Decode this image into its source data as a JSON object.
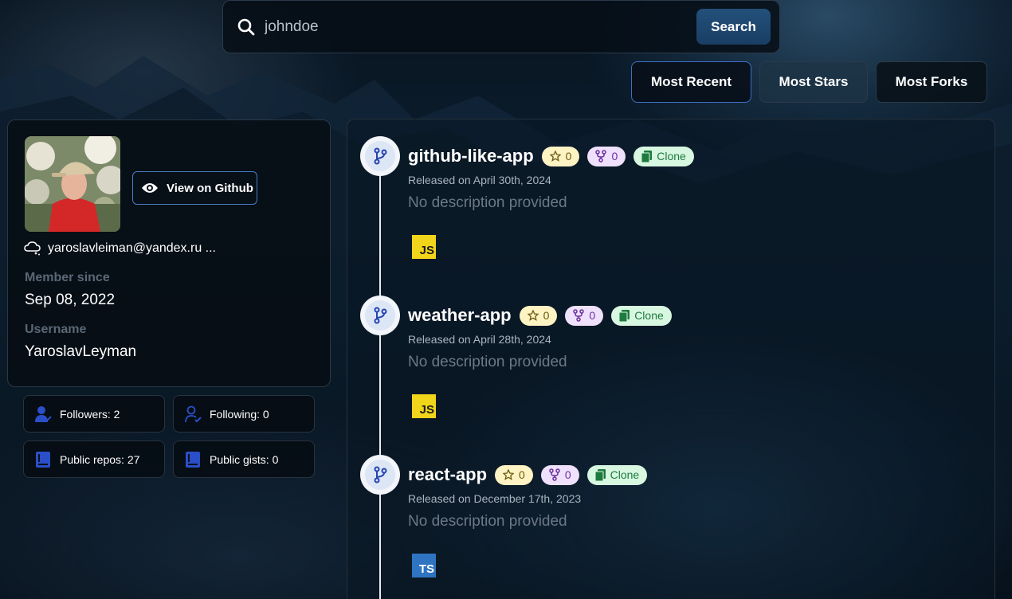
{
  "search": {
    "value": "johndoe",
    "button_label": "Search"
  },
  "sort": {
    "most_recent": "Most Recent",
    "most_stars": "Most Stars",
    "most_forks": "Most Forks",
    "active": "Most Recent"
  },
  "profile": {
    "view_button_label": "View on Github",
    "email": "yaroslavleiman@yandex.ru ...",
    "member_since_label": "Member since",
    "member_since_value": "Sep 08, 2022",
    "username_label": "Username",
    "username_value": "YaroslavLeyman"
  },
  "stats": {
    "followers": "Followers: 2",
    "following": "Following: 0",
    "public_repos": "Public repos: 27",
    "public_gists": "Public gists: 0"
  },
  "repos": [
    {
      "name": "github-like-app",
      "stars": "0",
      "forks": "0",
      "clone_label": "Clone",
      "released": "Released on April 30th, 2024",
      "description": "No description provided",
      "language": "JS"
    },
    {
      "name": "weather-app",
      "stars": "0",
      "forks": "0",
      "clone_label": "Clone",
      "released": "Released on April 28th, 2024",
      "description": "No description provided",
      "language": "JS"
    },
    {
      "name": "react-app",
      "stars": "0",
      "forks": "0",
      "clone_label": "Clone",
      "released": "Released on December 17th, 2023",
      "description": "No description provided",
      "language": "TS"
    }
  ],
  "colors": {
    "accent": "#1a3e64",
    "active_border": "#3f6fc6",
    "star_pill": "#fdf3c3",
    "fork_pill": "#efe1fb",
    "clone_pill": "#d7f7e1",
    "js": "#f0d51b",
    "ts": "#2f74c0"
  },
  "icons": {
    "search": "search-icon",
    "eye": "eye-icon",
    "email": "cloud-icon",
    "followers": "user-check-icon",
    "following": "user-check-outline-icon",
    "repos": "book-icon",
    "gists": "book-icon",
    "repo": "git-branch-icon",
    "star": "star-icon",
    "fork": "fork-icon",
    "clone": "copy-icon"
  }
}
